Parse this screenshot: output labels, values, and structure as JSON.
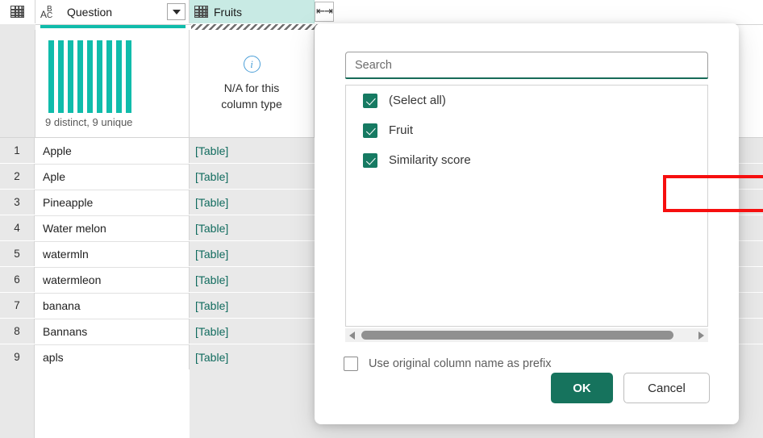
{
  "grid": {
    "columns": [
      {
        "name": "Question",
        "type_icon": "abc-text-type-icon",
        "has_filter_dropdown": true,
        "quality_bar_color": "#10bcab",
        "profile_summary": "9 distinct, 9 unique",
        "histogram_bars": [
          90,
          90,
          90,
          90,
          90,
          90,
          90,
          90,
          90
        ]
      },
      {
        "name": "Fruits",
        "type_icon": "table-icon",
        "has_expand_button": true,
        "expand_glyph": "⇞",
        "quality_bar_style": "hatched",
        "profile_info_icon": "info-icon",
        "profile_message_line1": "N/A for this",
        "profile_message_line2": "column type"
      }
    ],
    "rows": [
      {
        "num": "1",
        "question": "Apple",
        "fruits": "[Table]"
      },
      {
        "num": "2",
        "question": "Aple",
        "fruits": "[Table]"
      },
      {
        "num": "3",
        "question": "Pineapple",
        "fruits": "[Table]"
      },
      {
        "num": "4",
        "question": "Water melon",
        "fruits": "[Table]"
      },
      {
        "num": "5",
        "question": "watermln",
        "fruits": "[Table]"
      },
      {
        "num": "6",
        "question": "watermleon",
        "fruits": "[Table]"
      },
      {
        "num": "7",
        "question": "banana",
        "fruits": "[Table]"
      },
      {
        "num": "8",
        "question": "Bannans",
        "fruits": "[Table]"
      },
      {
        "num": "9",
        "question": "apls",
        "fruits": "[Table]"
      }
    ]
  },
  "dialog": {
    "search": {
      "placeholder": "Search",
      "value": ""
    },
    "list": [
      {
        "label": "(Select all)",
        "checked": true,
        "highlighted": false
      },
      {
        "label": "Fruit",
        "checked": true,
        "highlighted": false
      },
      {
        "label": "Similarity score",
        "checked": true,
        "highlighted": true
      }
    ],
    "prefix_option": {
      "label": "Use original column name as prefix",
      "checked": false
    },
    "buttons": {
      "ok": "OK",
      "cancel": "Cancel"
    },
    "accent_color": "#16735d",
    "highlight_color": "#f60f0f"
  }
}
